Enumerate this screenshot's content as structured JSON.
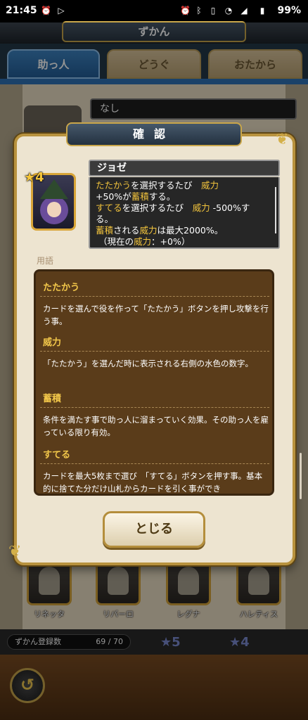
{
  "status_bar": {
    "time": "21:45",
    "battery": "99%"
  },
  "header": {
    "title": "ずかん"
  },
  "tabs": [
    {
      "label": "助っ人",
      "active": true
    },
    {
      "label": "どうぐ",
      "active": false
    },
    {
      "label": "おたから",
      "active": false
    }
  ],
  "background": {
    "name_strip": "なし",
    "cards": [
      {
        "name": "リネッタ"
      },
      {
        "name": "リバーロ"
      },
      {
        "name": "レグナ"
      },
      {
        "name": "ハレティス"
      }
    ],
    "registration_label": "ずかん登録数",
    "registration_count": "69 / 70",
    "star_5": "★5",
    "star_4": "★4"
  },
  "dialog": {
    "title": "確認",
    "rarity": "★4",
    "character_name": "ジョゼ",
    "effect": {
      "line1_hl": "たたかう",
      "line1": "を選択するたび　",
      "line1_hl2": "威力",
      "line2": "+50%が",
      "line2_hl": "蓄積",
      "line2_end": "する。",
      "line3_hl": "すてる",
      "line3": "を選択するたび　",
      "line3_hl2": "威力",
      "line3_end": " -500%す",
      "line4": "る。",
      "line5_hl": "蓄積",
      "line5": "される",
      "line5_hl2": "威力",
      "line5_end": "は最大2000%。",
      "line6": "（現在の",
      "line6_hl": "威力",
      "line6_end": "：+0%）"
    },
    "terms_label": "用語",
    "terms": [
      {
        "title": "たたかう",
        "text": "カードを選んで役を作って「たたかう」ボタンを押し攻撃を行う事。"
      },
      {
        "title": "威力",
        "text": "「たたかう」を選んだ時に表示される右側の水色の数字。"
      },
      {
        "title": "蓄積",
        "text": "条件を満たす事で助っ人に溜まっていく効果。その助っ人を雇っている限り有効。"
      },
      {
        "title": "すてる",
        "text": "カードを最大5枚まで選び　「すてる」ボタンを押す事。基本的に捨てた分だけ山札からカードを引く事ができ"
      }
    ],
    "close_label": "とじる"
  },
  "colors": {
    "accent_gold": "#f0c23c",
    "tab_active": "#2f73b5",
    "panel_brown": "#5a3c1a"
  }
}
